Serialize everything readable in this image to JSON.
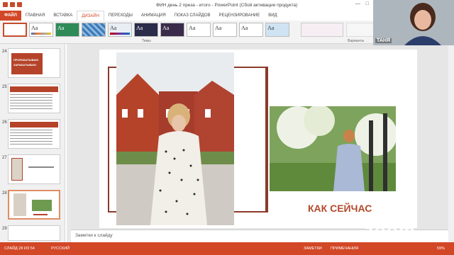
{
  "titlebar": {
    "title": "ФИН день 2 преза - итого - PowerPoint (Сбой активации продукта)"
  },
  "tabs": [
    {
      "label": "ФАЙЛ"
    },
    {
      "label": "ГЛАВНАЯ"
    },
    {
      "label": "ВСТАВКА"
    },
    {
      "label": "ДИЗАЙН"
    },
    {
      "label": "ПЕРЕХОДЫ"
    },
    {
      "label": "АНИМАЦИЯ"
    },
    {
      "label": "ПОКАЗ СЛАЙДОВ"
    },
    {
      "label": "РЕЦЕНЗИРОВАНИЕ"
    },
    {
      "label": "ВИД"
    }
  ],
  "ribbon": {
    "themes_label": "Темы",
    "variants_label": "Варианты",
    "theme_glyph": "Aa"
  },
  "slides_panel": [
    {
      "num": "24",
      "text": "ПРОРАБАТЫВАЮ  ЗАРАБАТЫВАЮ"
    },
    {
      "num": "25",
      "text": ""
    },
    {
      "num": "26",
      "text": ""
    },
    {
      "num": "27",
      "text": ""
    },
    {
      "num": "28",
      "text": ""
    },
    {
      "num": "29",
      "text": ""
    }
  ],
  "slide": {
    "heading": "КАК СЕЙЧАС"
  },
  "notes": {
    "placeholder": "Заметки к слайду"
  },
  "status": {
    "slide_count": "СЛАЙД 28 ИЗ 54",
    "language": "РУССКИЙ",
    "notes_btn": "ЗАМЕТКИ",
    "comments_btn": "ПРИМЕЧАНИЯ",
    "zoom": "59%"
  },
  "webcam": {
    "name": "ТАНЯ"
  },
  "watermark": "zoom",
  "colors": {
    "accent": "#d24726",
    "frame": "#8b3a2a",
    "heading": "#b24a2e"
  }
}
